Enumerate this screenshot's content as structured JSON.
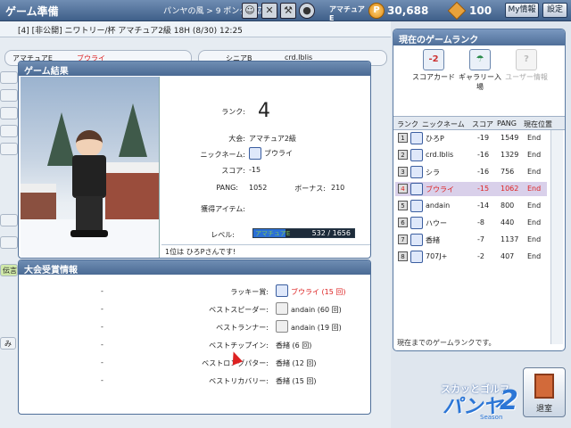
{
  "topbar": {
    "title": "ゲーム準備",
    "location": "パンヤの風 > 9 ポンタの広場",
    "rank_badge": "アマチュアE",
    "pang_value": "30,688",
    "cookie_value": "100",
    "myinfo_label": "My情報",
    "settings_label": "設定"
  },
  "room": {
    "info": "[4] [非公開] ニワトリー/杯  アマチュア2級 18H (8/30) 12:25"
  },
  "players": [
    {
      "rank": "アマチュアE",
      "name": "ブウライ"
    },
    {
      "rank": "シニアB",
      "name": "crd.Iblis"
    }
  ],
  "side_tabs": {
    "chat": "伝言",
    "me": "み"
  },
  "result": {
    "header": "ゲーム結果",
    "rank_label": "ランク:",
    "rank_value": "4",
    "tournament_label": "大会:",
    "tournament_value": "アマチュア2級",
    "nickname_label": "ニックネーム:",
    "nickname_value": "ブウライ",
    "score_label": "スコア:",
    "score_value": "-15",
    "pang_label": "PANG:",
    "pang_value": "1052",
    "bonus_label": "ボーナス:",
    "bonus_value": "210",
    "items_label": "獲得アイテム:",
    "level_label": "レベル:",
    "level_name": "アマチュアE",
    "level_text": "532 / 1656",
    "level_progress": 0.32,
    "footer": "1位は ひろPさんです!"
  },
  "awards": {
    "header": "大会受賞情報",
    "rows": [
      {
        "dash": "-",
        "name": "ラッキー賞:",
        "winner": "ブウライ (15 回)",
        "highlight": true,
        "avatar": "blue"
      },
      {
        "dash": "-",
        "name": "ベストスピーダー:",
        "winner": "andain (60 回)",
        "highlight": false,
        "avatar": "gray"
      },
      {
        "dash": "-",
        "name": "ベストランナー:",
        "winner": "andain (19 回)",
        "highlight": false,
        "avatar": "gray"
      },
      {
        "dash": "-",
        "name": "ベストチップイン:",
        "winner": "香緒 (6 回)",
        "highlight": false,
        "avatar": "none"
      },
      {
        "dash": "-",
        "name": "ベストロングパター:",
        "winner": "香緒 (12 回)",
        "highlight": false,
        "avatar": "none"
      },
      {
        "dash": "-",
        "name": "ベストリカバリー:",
        "winner": "香緒 (15 回)",
        "highlight": false,
        "avatar": "none"
      }
    ]
  },
  "ranking": {
    "header": "現在のゲームランク",
    "tools": {
      "scorecard": "スコアカード",
      "gallery": "ギャラリー入場",
      "userinfo": "ユーザー情報",
      "scorecard_badge": "-2"
    },
    "columns": {
      "rank": "ランク",
      "nick": "ニックネーム",
      "score": "スコア",
      "pang": "PANG",
      "pos": "現在位置"
    },
    "rows": [
      {
        "rank": "1",
        "name": "ひろP",
        "score": "-19",
        "pang": "1549",
        "pos": "End"
      },
      {
        "rank": "2",
        "name": "crd.Iblis",
        "score": "-16",
        "pang": "1329",
        "pos": "End"
      },
      {
        "rank": "3",
        "name": "シラ",
        "score": "-16",
        "pang": "756",
        "pos": "End"
      },
      {
        "rank": "4",
        "name": "ブウライ",
        "score": "-15",
        "pang": "1062",
        "pos": "End"
      },
      {
        "rank": "5",
        "name": "andain",
        "score": "-14",
        "pang": "800",
        "pos": "End"
      },
      {
        "rank": "6",
        "name": "ハウー",
        "score": "-8",
        "pang": "440",
        "pos": "End"
      },
      {
        "rank": "7",
        "name": "香緒",
        "score": "-7",
        "pang": "1137",
        "pos": "End"
      },
      {
        "rank": "8",
        "name": "707J+",
        "score": "-2",
        "pang": "407",
        "pos": "End"
      }
    ],
    "footer": "現在までのゲームランクです。"
  },
  "logo": {
    "line1": "スカッとゴルフ",
    "line2": "パンヤ",
    "line3": "2",
    "season": "Season"
  },
  "exit_label": "退室"
}
